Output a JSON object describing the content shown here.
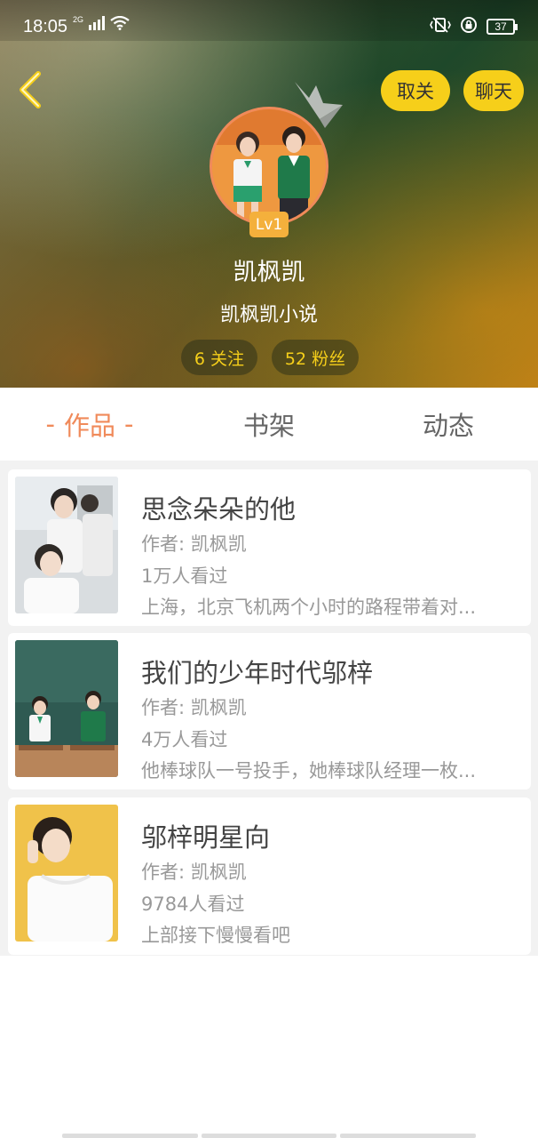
{
  "status_bar": {
    "time": "18:05",
    "network": "2G",
    "battery": "37",
    "icons": [
      "signal-icon",
      "wifi-icon",
      "vibrate-icon",
      "rotation-lock-icon",
      "battery-icon"
    ]
  },
  "header": {
    "back_icon": "chevron-left-icon",
    "unfollow_label": "取关",
    "chat_label": "聊天",
    "level": "Lv1",
    "user_name": "凯枫凯",
    "user_subtitle": "凯枫凯小说",
    "follow_stat": "6 关注",
    "fans_stat": "52 粉丝"
  },
  "tabs": [
    {
      "label": "作品",
      "active": true
    },
    {
      "label": "书架",
      "active": false
    },
    {
      "label": "动态",
      "active": false
    }
  ],
  "works": [
    {
      "title": "思念朵朵的他",
      "author": "作者: 凯枫凯",
      "views": "1万人看过",
      "description": "上海，北京飞机两个小时的路程带着对..."
    },
    {
      "title": "我们的少年时代邬梓",
      "author": "作者: 凯枫凯",
      "views": "4万人看过",
      "description": "他棒球队一号投手，她棒球队经理一枚..."
    },
    {
      "title": "邬梓明星向",
      "author": "作者: 凯枫凯",
      "views": "9784人看过",
      "description": "上部接下慢慢看吧"
    }
  ],
  "colors": {
    "accent": "#f08a5a",
    "button_yellow": "#f6cf1a",
    "level_badge": "#f4b03c"
  }
}
